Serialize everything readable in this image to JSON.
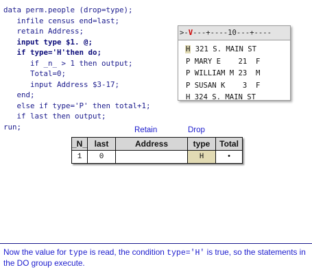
{
  "code": {
    "lines": [
      "data perm.people (drop=type);",
      "   infile census end=last;",
      "   retain Address;",
      "   input type $1. @;",
      "   if type='H'then do;",
      "      if _n_ > 1 then output;",
      "      Total=0;",
      "      input Address $3-17;",
      "   end;",
      "   else if type='P' then total+1;",
      "   if last then output;",
      "run;"
    ]
  },
  "raw_data": {
    "ruler_prefix": ">-",
    "ruler_pointer": "V",
    "ruler_rest": "---+----10---+----",
    "records": [
      {
        "first": "H",
        "rest": " 321 S. MAIN ST"
      },
      {
        "first": "P",
        "rest": " MARY E    21  F"
      },
      {
        "first": "P",
        "rest": " WILLIAM M 23  M"
      },
      {
        "first": "P",
        "rest": " SUSAN K    3  F"
      },
      {
        "first": "H",
        "rest": " 324 S. MAIN ST"
      }
    ]
  },
  "pdv": {
    "retain_label": "Retain",
    "drop_label": "Drop",
    "headers": [
      "_N_",
      "last",
      "Address",
      "type",
      "Total"
    ],
    "values": [
      "1",
      "0",
      "",
      "H",
      "•"
    ]
  },
  "caption": {
    "part1": "Now the value for ",
    "var1": "type",
    "part2": " is read, the condition ",
    "cond": "type='H'",
    "part3": " is true, so the statements in the DO group execute."
  }
}
